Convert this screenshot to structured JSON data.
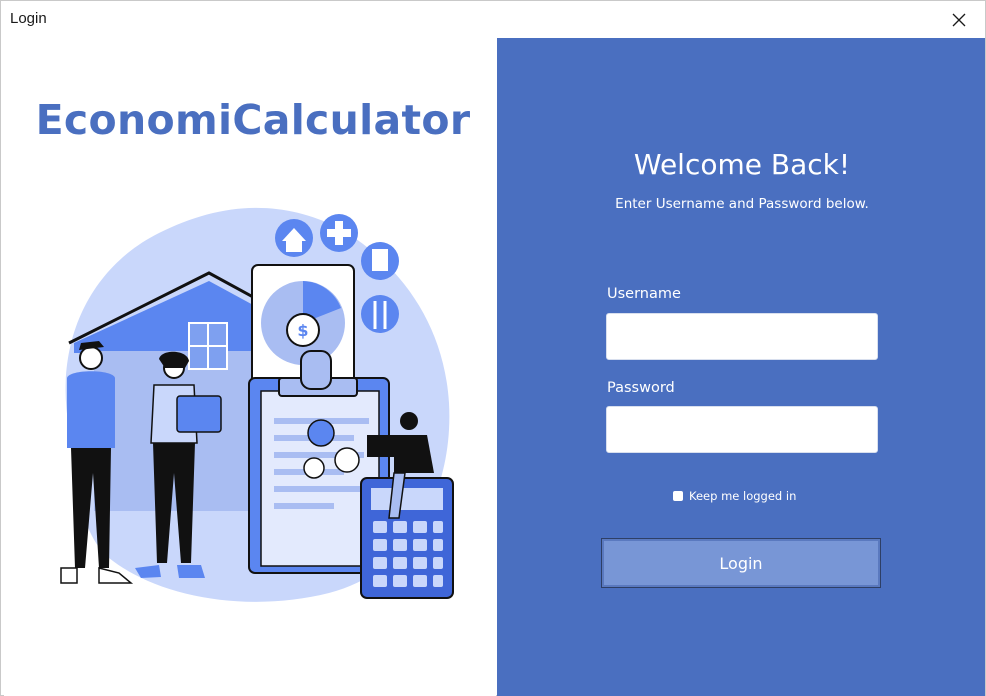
{
  "window": {
    "title": "Login",
    "close_icon": "close-icon"
  },
  "brand": {
    "name": "EconomiCalculator"
  },
  "login": {
    "heading": "Welcome Back!",
    "subtitle": "Enter Username and Password below.",
    "username_label": "Username",
    "username_value": "",
    "password_label": "Password",
    "password_value": "",
    "keep_logged_in_label": "Keep me logged in",
    "keep_logged_in_checked": false,
    "submit_label": "Login"
  },
  "colors": {
    "accent": "#4a6fc0",
    "button": "#7896d6",
    "illustration_light": "#c9d7fb",
    "illustration_mid": "#5b86f0",
    "ink": "#111111"
  }
}
